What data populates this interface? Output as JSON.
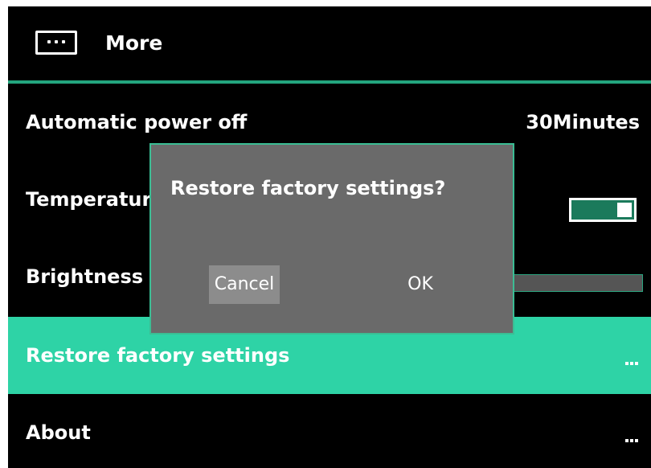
{
  "header": {
    "icon": "more-icon",
    "title": "More"
  },
  "settings": [
    {
      "label": "Automatic power off",
      "value": "30Minutes"
    },
    {
      "label": "Temperature",
      "control": "toggle",
      "state": "on"
    },
    {
      "label": "Brightness",
      "control": "slider"
    },
    {
      "label": "Restore factory settings",
      "trailing": "more-icon",
      "selected": true
    },
    {
      "label": "About",
      "trailing": "more-icon"
    }
  ],
  "dialog": {
    "title": "Restore factory settings?",
    "cancel_label": "Cancel",
    "ok_label": "OK"
  },
  "colors": {
    "accent": "#2ed3a6",
    "divider": "#23a57e",
    "dialog_bg": "#6a6a6a",
    "toggle_on": "#1b7a5b"
  }
}
